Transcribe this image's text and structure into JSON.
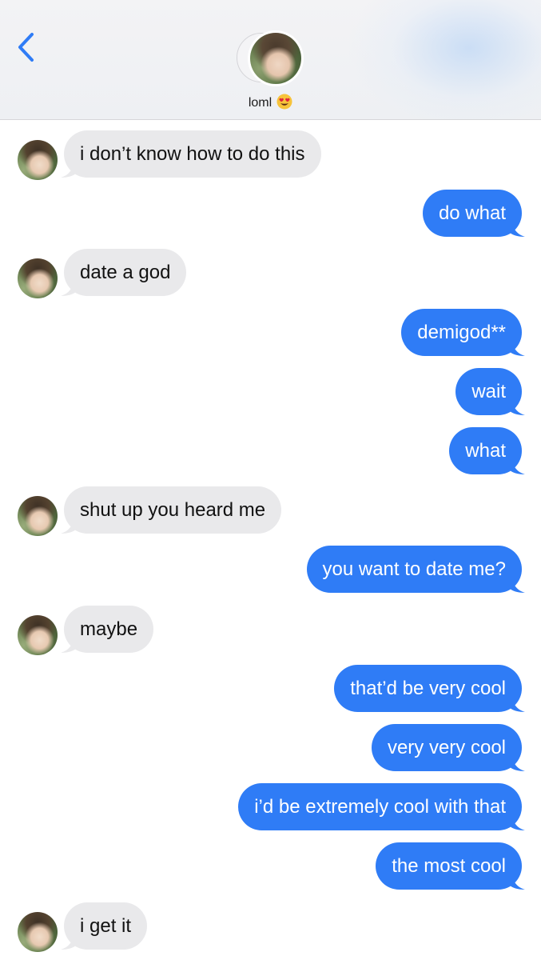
{
  "header": {
    "contact_name": "loml",
    "contact_emoji": "heart-eyes-emoji",
    "icons": {
      "back": "chevron-left-icon"
    },
    "accent_color": "#2f7cf6"
  },
  "colors": {
    "incoming_bubble": "#e9e9eb",
    "outgoing_bubble": "#2f7cf6",
    "incoming_text": "#111111",
    "outgoing_text": "#ffffff"
  },
  "messages": [
    {
      "dir": "in",
      "text": "i don’t know how to do this"
    },
    {
      "dir": "out",
      "text": "do what"
    },
    {
      "dir": "in",
      "text": "date a god"
    },
    {
      "dir": "out",
      "text": "demigod**"
    },
    {
      "dir": "out",
      "text": "wait"
    },
    {
      "dir": "out",
      "text": "what"
    },
    {
      "dir": "in",
      "text": "shut up you heard me"
    },
    {
      "dir": "out",
      "text": "you want to date me?"
    },
    {
      "dir": "in",
      "text": "maybe"
    },
    {
      "dir": "out",
      "text": "that’d be very cool"
    },
    {
      "dir": "out",
      "text": "very very cool"
    },
    {
      "dir": "out",
      "text": "i’d be extremely cool with that"
    },
    {
      "dir": "out",
      "text": "the most cool"
    },
    {
      "dir": "in",
      "text": "i get it"
    }
  ]
}
